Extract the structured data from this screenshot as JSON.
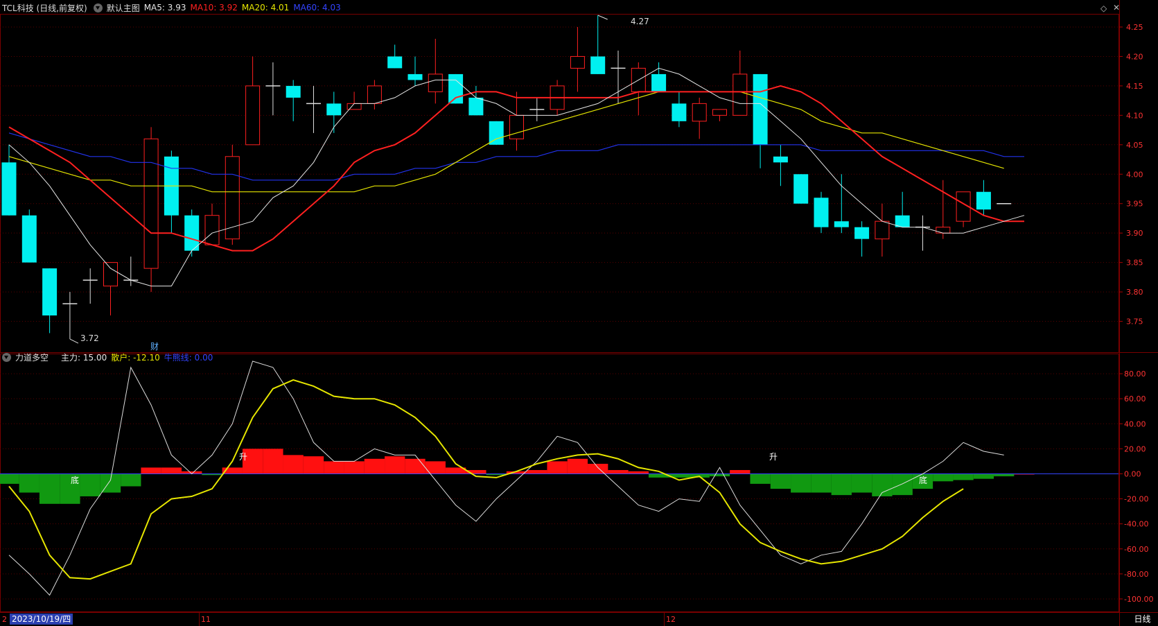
{
  "header": {
    "title": "TCL科技 (日线,前复权)",
    "template": "默认主图",
    "ma5": "MA5: 3.93",
    "ma10": "MA10: 3.92",
    "ma20": "MA20: 4.01",
    "ma60": "MA60: 4.03"
  },
  "indicator_header": {
    "name": "力道多空",
    "main": "主力: 15.00",
    "retail": "散户: -12.10",
    "bull_bear": "牛熊线: 0.00"
  },
  "colors": {
    "up": "#ff2020",
    "down": "#00f0f0",
    "ma5": "#e6e6e6",
    "ma10": "#ff2020",
    "ma20": "#e6e600",
    "ma60": "#2233ee",
    "grid": "#5a0000"
  },
  "annotations": {
    "high": "4.27",
    "low": "3.72",
    "fin": "财",
    "rise1": "升",
    "rise2": "升",
    "bottom1": "底",
    "bottom2": "底"
  },
  "xaxis": {
    "m11": "11",
    "m12": "12",
    "cursor_date": "2023/10/19/四",
    "period": "日线",
    "left_mark": "2"
  },
  "price_axis": [
    "4.25",
    "4.20",
    "4.15",
    "4.10",
    "4.05",
    "4.00",
    "3.95",
    "3.90",
    "3.85",
    "3.80",
    "3.75"
  ],
  "ind_axis": [
    "80.00",
    "60.00",
    "40.00",
    "20.00",
    "0.00",
    "-20.00",
    "-40.00",
    "-60.00",
    "-80.00",
    "-100.00"
  ],
  "chart_data": [
    {
      "type": "candlestick",
      "title": "TCL科技 (日线,前复权)",
      "ylim": [
        3.7,
        4.27
      ],
      "candles": [
        [
          4.02,
          4.05,
          3.93,
          3.93
        ],
        [
          3.93,
          3.94,
          3.85,
          3.85
        ],
        [
          3.84,
          3.84,
          3.73,
          3.76
        ],
        [
          3.78,
          3.8,
          3.72,
          3.78
        ],
        [
          3.82,
          3.84,
          3.78,
          3.82
        ],
        [
          3.81,
          3.85,
          3.76,
          3.85
        ],
        [
          3.82,
          3.86,
          3.81,
          3.82
        ],
        [
          3.84,
          4.08,
          3.8,
          4.06
        ],
        [
          4.03,
          4.04,
          3.9,
          3.93
        ],
        [
          3.93,
          3.94,
          3.86,
          3.87
        ],
        [
          3.88,
          3.95,
          3.88,
          3.93
        ],
        [
          3.89,
          4.05,
          3.88,
          4.03
        ],
        [
          4.05,
          4.2,
          4.05,
          4.15
        ],
        [
          4.15,
          4.19,
          4.1,
          4.15
        ],
        [
          4.15,
          4.16,
          4.09,
          4.13
        ],
        [
          4.12,
          4.15,
          4.07,
          4.12
        ],
        [
          4.12,
          4.14,
          4.07,
          4.1
        ],
        [
          4.11,
          4.14,
          4.11,
          4.12
        ],
        [
          4.12,
          4.16,
          4.11,
          4.15
        ],
        [
          4.2,
          4.22,
          4.18,
          4.18
        ],
        [
          4.17,
          4.2,
          4.15,
          4.16
        ],
        [
          4.14,
          4.23,
          4.12,
          4.17
        ],
        [
          4.17,
          4.17,
          4.12,
          4.12
        ],
        [
          4.13,
          4.15,
          4.1,
          4.1
        ],
        [
          4.09,
          4.09,
          4.05,
          4.05
        ],
        [
          4.06,
          4.14,
          4.04,
          4.1
        ],
        [
          4.11,
          4.13,
          4.09,
          4.11
        ],
        [
          4.11,
          4.16,
          4.1,
          4.15
        ],
        [
          4.18,
          4.25,
          4.14,
          4.2
        ],
        [
          4.2,
          4.27,
          4.17,
          4.17
        ],
        [
          4.18,
          4.21,
          4.12,
          4.18
        ],
        [
          4.14,
          4.19,
          4.1,
          4.18
        ],
        [
          4.17,
          4.19,
          4.14,
          4.14
        ],
        [
          4.12,
          4.14,
          4.08,
          4.09
        ],
        [
          4.09,
          4.13,
          4.06,
          4.12
        ],
        [
          4.1,
          4.11,
          4.09,
          4.11
        ],
        [
          4.1,
          4.21,
          4.1,
          4.17
        ],
        [
          4.17,
          4.17,
          4.01,
          4.05
        ],
        [
          4.03,
          4.05,
          3.98,
          4.02
        ],
        [
          4.0,
          4.0,
          3.95,
          3.95
        ],
        [
          3.96,
          3.97,
          3.9,
          3.91
        ],
        [
          3.92,
          4.0,
          3.9,
          3.91
        ],
        [
          3.91,
          3.92,
          3.86,
          3.89
        ],
        [
          3.89,
          3.95,
          3.86,
          3.92
        ],
        [
          3.93,
          3.97,
          3.91,
          3.91
        ],
        [
          3.91,
          3.93,
          3.87,
          3.91
        ],
        [
          3.9,
          3.99,
          3.89,
          3.91
        ],
        [
          3.92,
          3.97,
          3.91,
          3.97
        ],
        [
          3.97,
          3.99,
          3.93,
          3.94
        ],
        [
          3.95,
          3.95,
          3.95,
          3.95
        ]
      ],
      "ma5": [
        4.05,
        4.02,
        3.98,
        3.93,
        3.88,
        3.84,
        3.82,
        3.81,
        3.81,
        3.87,
        3.9,
        3.91,
        3.92,
        3.96,
        3.98,
        4.02,
        4.08,
        4.12,
        4.12,
        4.13,
        4.15,
        4.16,
        4.16,
        4.13,
        4.12,
        4.1,
        4.1,
        4.1,
        4.11,
        4.12,
        4.14,
        4.16,
        4.18,
        4.17,
        4.15,
        4.13,
        4.12,
        4.12,
        4.09,
        4.06,
        4.02,
        3.98,
        3.95,
        3.92,
        3.91,
        3.91,
        3.9,
        3.9,
        3.91,
        3.92,
        3.93
      ],
      "ma10": [
        4.08,
        4.06,
        4.04,
        4.02,
        3.99,
        3.96,
        3.93,
        3.9,
        3.9,
        3.89,
        3.88,
        3.87,
        3.87,
        3.89,
        3.92,
        3.95,
        3.98,
        4.02,
        4.04,
        4.05,
        4.07,
        4.1,
        4.13,
        4.14,
        4.14,
        4.13,
        4.13,
        4.13,
        4.13,
        4.13,
        4.13,
        4.14,
        4.14,
        4.14,
        4.14,
        4.14,
        4.14,
        4.14,
        4.15,
        4.14,
        4.12,
        4.09,
        4.06,
        4.03,
        4.01,
        3.99,
        3.97,
        3.95,
        3.93,
        3.92,
        3.92
      ],
      "ma20": [
        4.03,
        4.02,
        4.01,
        4.0,
        3.99,
        3.99,
        3.98,
        3.98,
        3.98,
        3.98,
        3.97,
        3.97,
        3.97,
        3.97,
        3.97,
        3.97,
        3.97,
        3.97,
        3.98,
        3.98,
        3.99,
        4.0,
        4.02,
        4.04,
        4.06,
        4.07,
        4.08,
        4.09,
        4.1,
        4.11,
        4.12,
        4.13,
        4.14,
        4.14,
        4.14,
        4.14,
        4.14,
        4.13,
        4.12,
        4.11,
        4.09,
        4.08,
        4.07,
        4.07,
        4.06,
        4.05,
        4.04,
        4.03,
        4.02,
        4.01
      ],
      "ma60": [
        4.07,
        4.06,
        4.05,
        4.04,
        4.03,
        4.03,
        4.02,
        4.02,
        4.01,
        4.01,
        4.0,
        4.0,
        3.99,
        3.99,
        3.99,
        3.99,
        3.99,
        4.0,
        4.0,
        4.0,
        4.01,
        4.01,
        4.02,
        4.02,
        4.03,
        4.03,
        4.03,
        4.04,
        4.04,
        4.04,
        4.05,
        4.05,
        4.05,
        4.05,
        4.05,
        4.05,
        4.05,
        4.05,
        4.05,
        4.05,
        4.04,
        4.04,
        4.04,
        4.04,
        4.04,
        4.04,
        4.04,
        4.04,
        4.04,
        4.03,
        4.03
      ]
    },
    {
      "type": "histogram_line",
      "title": "力道多空",
      "ylim": [
        -110,
        95
      ],
      "bars": [
        -8,
        -15,
        -24,
        -24,
        -18,
        -15,
        -10,
        5,
        5,
        2,
        -1,
        5,
        20,
        20,
        15,
        14,
        10,
        10,
        12,
        14,
        12,
        10,
        5,
        3,
        -1,
        2,
        3,
        10,
        12,
        8,
        3,
        2,
        -3,
        -3,
        -3,
        -2,
        3,
        -8,
        -12,
        -15,
        -15,
        -17,
        -15,
        -18,
        -17,
        -12,
        -6,
        -5,
        -4,
        -2,
        0
      ],
      "main": [
        -65,
        -80,
        -97,
        -65,
        -28,
        -5,
        85,
        55,
        15,
        0,
        15,
        40,
        90,
        85,
        60,
        25,
        10,
        10,
        20,
        15,
        15,
        -5,
        -25,
        -38,
        -20,
        -5,
        10,
        30,
        25,
        5,
        -10,
        -25,
        -30,
        -20,
        -22,
        5,
        -25,
        -45,
        -65,
        -72,
        -65,
        -62,
        -40,
        -15,
        -8,
        0,
        10,
        25,
        18,
        15
      ],
      "retail": [
        -10,
        -30,
        -65,
        -83,
        -84,
        -78,
        -72,
        -32,
        -20,
        -18,
        -12,
        10,
        45,
        68,
        75,
        70,
        62,
        60,
        60,
        55,
        45,
        30,
        8,
        -2,
        -3,
        2,
        8,
        12,
        15,
        16,
        12,
        5,
        2,
        -5,
        -2,
        -15,
        -40,
        -55,
        -62,
        -68,
        -72,
        -70,
        -65,
        -60,
        -50,
        -35,
        -22,
        -12
      ]
    }
  ]
}
